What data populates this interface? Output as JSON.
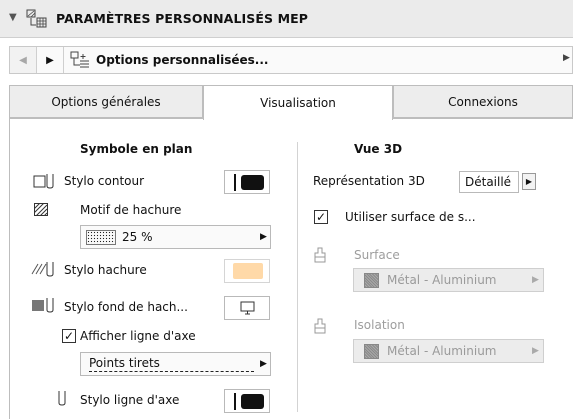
{
  "header": {
    "title": "PARAMÈTRES PERSONNALISÉS MEP"
  },
  "options_bar": {
    "label": "Options personnalisées..."
  },
  "tabs": [
    {
      "label": "Options générales"
    },
    {
      "label": "Visualisation"
    },
    {
      "label": "Connexions"
    }
  ],
  "left": {
    "heading": "Symbole en plan",
    "stylo_contour": "Stylo contour",
    "motif_hachure": "Motif de hachure",
    "motif_value": "25 %",
    "stylo_hachure": "Stylo hachure",
    "stylo_fond": "Stylo fond de hach...",
    "afficher_axe": "Afficher ligne d'axe",
    "axe_type": "Points tirets",
    "stylo_axe": "Stylo ligne d'axe",
    "hachure_color": "#ffd9a8"
  },
  "right": {
    "heading": "Vue 3D",
    "representation_label": "Représentation 3D",
    "representation_value": "Détaillé",
    "utiliser_surface": "Utiliser surface de s...",
    "surface_label": "Surface",
    "surface_value": "Métal - Aluminium",
    "isolation_label": "Isolation",
    "isolation_value": "Métal - Aluminium"
  }
}
